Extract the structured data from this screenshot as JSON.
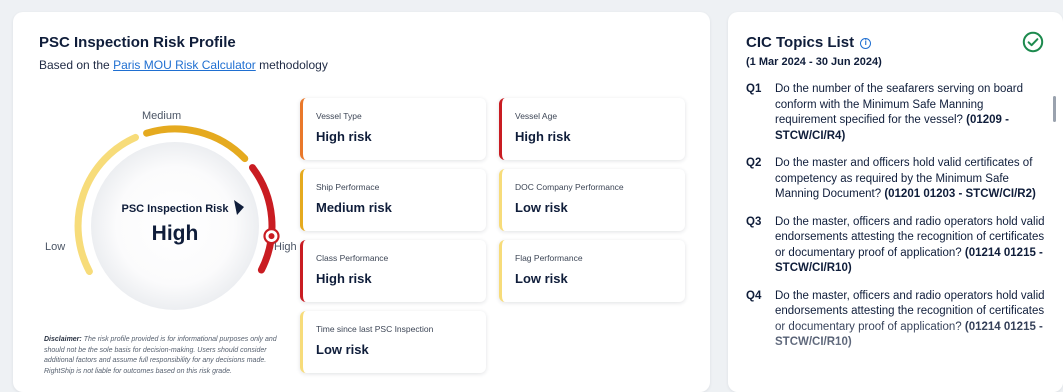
{
  "risk_profile": {
    "title": "PSC Inspection Risk Profile",
    "subtitle_prefix": "Based on the ",
    "subtitle_link": "Paris MOU Risk Calculator",
    "subtitle_suffix": " methodology",
    "gauge": {
      "label_medium": "Medium",
      "label_low": "Low",
      "label_high": "High",
      "inner_title": "PSC Inspection Risk",
      "inner_value": "High",
      "colors": {
        "low": "#f7dc7a",
        "medium": "#e5aa1f",
        "high": "#c91c22"
      }
    },
    "disclaimer_label": "Disclaimer:",
    "disclaimer_text": " The risk profile provided is for informational purposes only and should not be the sole basis for decision-making. Users should consider additional factors and assume full responsibility for any decisions made. RightShip is not liable for outcomes based on this risk grade.",
    "tiles": [
      {
        "label": "Vessel Type",
        "value": "High risk",
        "color": "#e9782a"
      },
      {
        "label": "Vessel Age",
        "value": "High risk",
        "color": "#c91c22"
      },
      {
        "label": "Ship Performace",
        "value": "Medium risk",
        "color": "#e5aa1f"
      },
      {
        "label": "DOC Company Performance",
        "value": "Low risk",
        "color": "#f7dc7a"
      },
      {
        "label": "Class Performance",
        "value": "High risk",
        "color": "#c91c22"
      },
      {
        "label": "Flag Performance",
        "value": "Low risk",
        "color": "#f7dc7a"
      },
      {
        "label": "Time since last PSC Inspection",
        "value": "Low risk",
        "color": "#f7dc7a"
      }
    ]
  },
  "cic": {
    "title": "CIC Topics List",
    "info_icon": "info-icon",
    "date_range": "(1 Mar 2024 - 30 Jun 2024)",
    "status_icon": "check-circle-icon",
    "status_color": "#1d8a4e",
    "questions": [
      {
        "num": "Q1",
        "text": "Do the number of the seafarers serving on board conform with the Minimum Safe Manning requirement specified for the vessel? ",
        "code": "(01209 - STCW/CI/R4)"
      },
      {
        "num": "Q2",
        "text": "Do the master and officers hold valid certificates of competency as required by the Minimum Safe Manning Document? ",
        "code": "(01201 01203 - STCW/CI/R2)"
      },
      {
        "num": "Q3",
        "text": "Do the master, officers and radio operators hold valid endorsements attesting the recognition of certificates or documentary proof of application? ",
        "code": "(01214 01215 - STCW/CI/R10)"
      },
      {
        "num": "Q4",
        "text": "Do the master, officers and radio operators hold valid endorsements attesting the recognition of certificates or documentary proof of application? ",
        "code": "(01214 01215 - STCW/CI/R10)"
      }
    ]
  }
}
